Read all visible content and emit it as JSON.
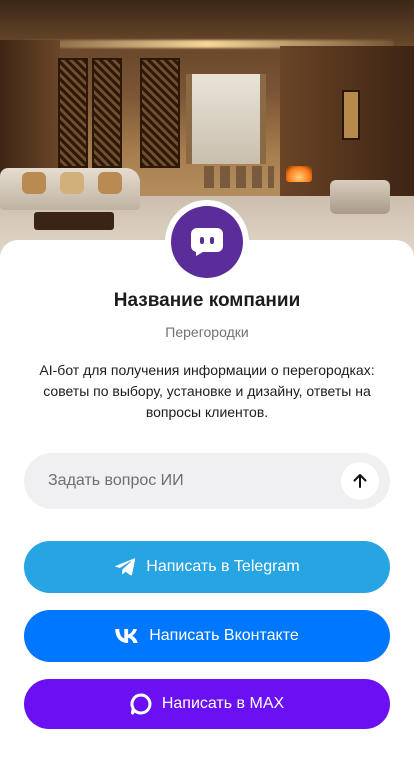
{
  "hero": {
    "image": "luxury-living-room-with-partitions"
  },
  "company": {
    "name": "Название компании",
    "category": "Перегородки",
    "description": "AI-бот для получения информации о перегородках: советы по выбору, установке и дизайну, ответы на вопросы клиентов.",
    "avatar_icon": "chat-bubble-icon",
    "avatar_color": "#5b2d9a"
  },
  "ask": {
    "placeholder": "Задать вопрос ИИ",
    "send_icon": "arrow-up-icon"
  },
  "actions": {
    "telegram": {
      "label": "Написать в Telegram",
      "icon": "telegram-icon",
      "color": "#27a4e2"
    },
    "vk": {
      "label": "Написать Вконтакте",
      "icon": "vk-icon",
      "color": "#0077ff"
    },
    "max": {
      "label": "Написать в MAX",
      "icon": "max-icon",
      "color": "#6a10f2"
    }
  }
}
